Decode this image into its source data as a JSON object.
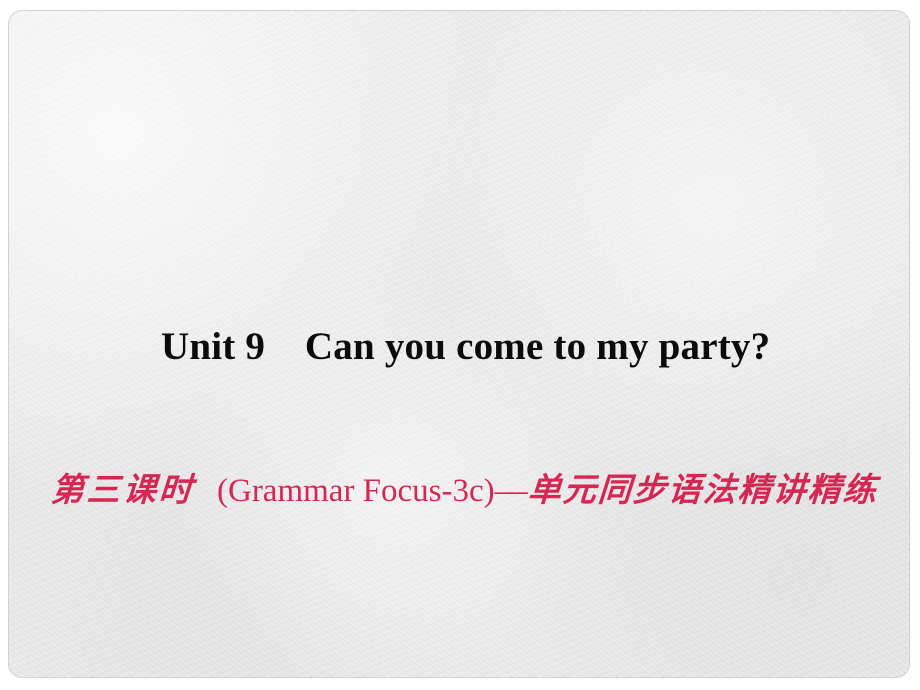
{
  "slide": {
    "background_color": "#e7e7e7",
    "frame_border_color": "#d2d2d2",
    "title": {
      "text": "Unit 9    Can you come to my party?",
      "color": "#0b0b0b"
    },
    "subtitle": {
      "color": "#d62753",
      "lead_cn": "第三课时",
      "english": "(Grammar Focus-3c)—",
      "tail_cn": "单元同步语法精讲精练",
      "full_text": "第三课时  (Grammar Focus-3c)—单元同步语法精讲精练"
    }
  }
}
